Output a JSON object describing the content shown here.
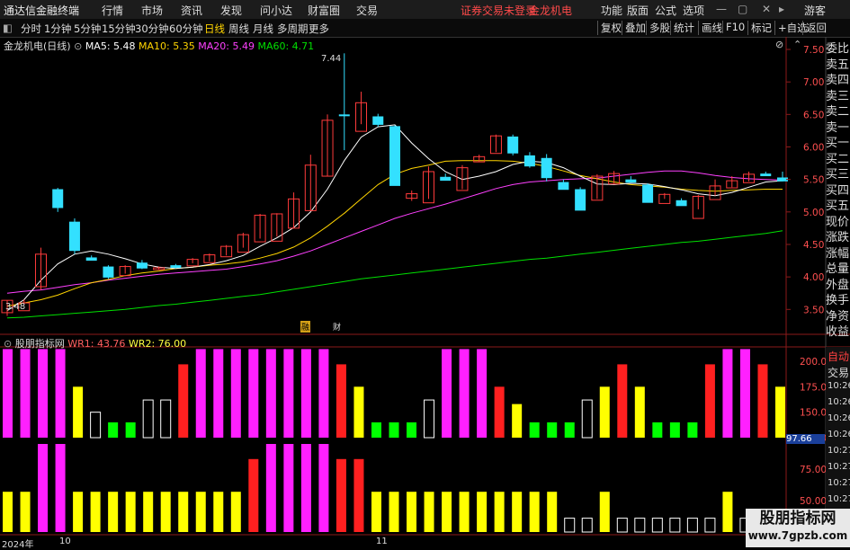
{
  "window": {
    "app_title": "通达信金融终端",
    "warning": "证券交易未登录",
    "stock_title": "金龙机电",
    "menus": [
      "行情",
      "市场",
      "资讯",
      "发现",
      "问小达",
      "财富圈",
      "交易"
    ],
    "right_menus": [
      "功能",
      "版面",
      "公式",
      "选项"
    ],
    "guest": "游客"
  },
  "toolbar": {
    "periods": [
      "分时",
      "1分钟",
      "5分钟",
      "15分钟",
      "30分钟",
      "60分钟",
      "日线",
      "周线",
      "月线",
      "多周期",
      "更多"
    ],
    "active": "日线",
    "right": [
      "复权",
      "叠加",
      "多股",
      "统计",
      "画线",
      "F10",
      "标记",
      "+自选",
      "返回"
    ]
  },
  "upper": {
    "name": "金龙机电(日线)",
    "ma": [
      {
        "label": "MA5: 5.48",
        "color": "#ffffff"
      },
      {
        "label": "MA10: 5.35",
        "color": "#ffd400"
      },
      {
        "label": "MA20: 5.49",
        "color": "#ff40ff"
      },
      {
        "label": "MA60: 4.71",
        "color": "#00e000"
      }
    ],
    "yaxis": [
      "7.50",
      "7.00",
      "6.50",
      "6.00",
      "5.50",
      "5.00",
      "4.50",
      "4.00",
      "3.50"
    ],
    "high_label": "7.44",
    "low_label": "3.48",
    "markers": [
      "融",
      "财"
    ]
  },
  "lower": {
    "name": "股朋指标网",
    "wr1": "WR1: 43.76",
    "wr2": "WR2: 76.00",
    "yaxis": [
      "200.0",
      "175.0",
      "150.0",
      "125.0",
      "75.00",
      "50.00",
      "25.00"
    ],
    "current": "97.66"
  },
  "date_axis": [
    "2024年",
    "10",
    "11"
  ],
  "sidepanel": [
    "委比",
    "卖五",
    "卖四",
    "卖三",
    "卖二",
    "卖一",
    "买一",
    "买二",
    "买三",
    "买四",
    "买五",
    "现价",
    "涨跌",
    "涨幅",
    "总量",
    "外盘",
    "换手",
    "净资",
    "收益"
  ],
  "sidebottom": [
    "自动",
    "交易",
    "10:26",
    "10:26",
    "10:26",
    "10:26",
    "10:27",
    "10:27",
    "10:27",
    "10:27",
    "10:27",
    "10:27"
  ],
  "watermark": {
    "line1": "股朋指标网",
    "line2": "www.7gpzb.com"
  },
  "chart_data": {
    "type": "candlestick",
    "candles": [
      [
        3.64,
        3.64,
        3.4,
        3.45,
        "r"
      ],
      [
        3.6,
        3.65,
        3.58,
        3.48,
        "r"
      ],
      [
        4.35,
        4.45,
        3.8,
        3.85,
        "r"
      ],
      [
        5.35,
        5.37,
        5.0,
        5.06,
        "c"
      ],
      [
        4.85,
        4.9,
        4.35,
        4.4,
        "c"
      ],
      [
        4.3,
        4.33,
        4.27,
        4.25,
        "c"
      ],
      [
        4.16,
        4.18,
        3.97,
        3.99,
        "c"
      ],
      [
        4.16,
        4.18,
        4.05,
        4.02,
        "r"
      ],
      [
        4.22,
        4.26,
        4.12,
        4.13,
        "c"
      ],
      [
        4.14,
        4.16,
        4.12,
        4.12,
        "r"
      ],
      [
        4.18,
        4.2,
        4.13,
        4.14,
        "c"
      ],
      [
        4.27,
        4.29,
        4.21,
        4.17,
        "r"
      ],
      [
        4.34,
        4.36,
        4.24,
        4.22,
        "r"
      ],
      [
        4.47,
        4.49,
        4.33,
        4.31,
        "r"
      ],
      [
        4.65,
        4.68,
        4.45,
        4.38,
        "r"
      ],
      [
        4.95,
        4.97,
        4.59,
        4.54,
        "r"
      ],
      [
        4.97,
        4.98,
        4.62,
        4.55,
        "r"
      ],
      [
        5.2,
        5.3,
        4.75,
        4.75,
        "r"
      ],
      [
        5.72,
        5.88,
        5.02,
        5.02,
        "r"
      ],
      [
        6.41,
        6.5,
        5.55,
        5.55,
        "r"
      ],
      [
        6.5,
        7.44,
        5.95,
        6.49,
        "c"
      ],
      [
        6.68,
        6.85,
        6.35,
        6.24,
        "r"
      ],
      [
        6.47,
        6.51,
        6.31,
        6.34,
        "c"
      ],
      [
        6.32,
        6.33,
        5.45,
        5.4,
        "c"
      ],
      [
        5.28,
        5.33,
        5.17,
        5.21,
        "r"
      ],
      [
        5.62,
        5.7,
        5.2,
        5.14,
        "r"
      ],
      [
        5.54,
        5.59,
        5.49,
        5.48,
        "c"
      ],
      [
        5.68,
        5.72,
        5.35,
        5.33,
        "r"
      ],
      [
        5.85,
        5.88,
        5.77,
        5.77,
        "r"
      ],
      [
        6.17,
        6.19,
        5.92,
        5.9,
        "r"
      ],
      [
        6.16,
        6.19,
        5.87,
        5.9,
        "c"
      ],
      [
        5.87,
        5.92,
        5.68,
        5.7,
        "c"
      ],
      [
        5.83,
        5.89,
        5.47,
        5.52,
        "c"
      ],
      [
        5.46,
        5.5,
        5.36,
        5.34,
        "c"
      ],
      [
        5.35,
        5.38,
        5.08,
        5.02,
        "c"
      ],
      [
        5.55,
        5.58,
        5.2,
        5.18,
        "r"
      ],
      [
        5.59,
        5.63,
        5.44,
        5.43,
        "r"
      ],
      [
        5.5,
        5.55,
        5.46,
        5.45,
        "c"
      ],
      [
        5.42,
        5.44,
        5.17,
        5.14,
        "c"
      ],
      [
        5.27,
        5.29,
        5.2,
        5.13,
        "r"
      ],
      [
        5.18,
        5.21,
        5.12,
        5.09,
        "c"
      ],
      [
        5.24,
        5.26,
        5.04,
        4.9,
        "r"
      ],
      [
        5.4,
        5.5,
        5.25,
        5.19,
        "r"
      ],
      [
        5.48,
        5.55,
        5.38,
        5.37,
        "r"
      ],
      [
        5.58,
        5.62,
        5.47,
        5.45,
        "r"
      ],
      [
        5.59,
        5.62,
        5.56,
        5.55,
        "c"
      ],
      [
        5.53,
        5.62,
        5.47,
        5.47,
        "c"
      ]
    ],
    "ma5": [
      3.48,
      3.65,
      3.95,
      4.2,
      4.35,
      4.4,
      4.35,
      4.28,
      4.2,
      4.15,
      4.13,
      4.15,
      4.19,
      4.25,
      4.33,
      4.47,
      4.6,
      4.76,
      5.0,
      5.35,
      5.79,
      6.15,
      6.31,
      6.34,
      6.06,
      5.82,
      5.62,
      5.5,
      5.55,
      5.62,
      5.73,
      5.78,
      5.76,
      5.68,
      5.55,
      5.43,
      5.42,
      5.44,
      5.43,
      5.39,
      5.34,
      5.28,
      5.25,
      5.3,
      5.38,
      5.46,
      5.48
    ],
    "ma10": [
      3.55,
      3.6,
      3.65,
      3.72,
      3.82,
      3.91,
      3.96,
      4.02,
      4.06,
      4.09,
      4.13,
      4.15,
      4.18,
      4.2,
      4.23,
      4.29,
      4.36,
      4.46,
      4.6,
      4.78,
      4.98,
      5.2,
      5.42,
      5.58,
      5.67,
      5.72,
      5.78,
      5.79,
      5.79,
      5.79,
      5.78,
      5.75,
      5.7,
      5.63,
      5.56,
      5.51,
      5.46,
      5.42,
      5.4,
      5.38,
      5.35,
      5.33,
      5.32,
      5.33,
      5.34,
      5.35,
      5.35
    ],
    "ma20": [
      3.75,
      3.78,
      3.8,
      3.84,
      3.88,
      3.91,
      3.95,
      3.98,
      4.01,
      4.04,
      4.06,
      4.08,
      4.1,
      4.12,
      4.16,
      4.2,
      4.25,
      4.32,
      4.4,
      4.5,
      4.6,
      4.7,
      4.8,
      4.9,
      4.98,
      5.05,
      5.12,
      5.2,
      5.28,
      5.36,
      5.42,
      5.46,
      5.48,
      5.5,
      5.51,
      5.52,
      5.55,
      5.58,
      5.61,
      5.63,
      5.63,
      5.6,
      5.56,
      5.53,
      5.51,
      5.5,
      5.49
    ],
    "ma60": [
      3.37,
      3.38,
      3.4,
      3.42,
      3.44,
      3.46,
      3.48,
      3.5,
      3.53,
      3.56,
      3.58,
      3.61,
      3.64,
      3.67,
      3.7,
      3.73,
      3.77,
      3.81,
      3.85,
      3.89,
      3.93,
      3.97,
      4.0,
      4.03,
      4.06,
      4.09,
      4.12,
      4.15,
      4.18,
      4.21,
      4.24,
      4.27,
      4.29,
      4.32,
      4.35,
      4.38,
      4.41,
      4.44,
      4.47,
      4.5,
      4.53,
      4.55,
      4.58,
      4.61,
      4.64,
      4.67,
      4.71
    ],
    "wr1_colors": [
      "m",
      "m",
      "m",
      "m",
      "y",
      "w",
      "g",
      "g",
      "w",
      "w",
      "r",
      "m",
      "m",
      "m",
      "m",
      "m",
      "m",
      "m",
      "m",
      "r",
      "y",
      "g",
      "g",
      "g",
      "w",
      "m",
      "m",
      "m",
      "r",
      "y",
      "g",
      "g",
      "g",
      "w",
      "y",
      "r",
      "y",
      "g",
      "g",
      "g",
      "r",
      "m",
      "m",
      "r",
      "y"
    ],
    "wr1_values": [
      212,
      212,
      212,
      212,
      175,
      150,
      140,
      140,
      162,
      162,
      197,
      212,
      212,
      212,
      212,
      212,
      212,
      212,
      212,
      197,
      175,
      140,
      140,
      140,
      162,
      212,
      212,
      212,
      175,
      158,
      140,
      140,
      140,
      162,
      175,
      197,
      175,
      140,
      140,
      140,
      197,
      212,
      212,
      197,
      175
    ],
    "wr2_colors": [
      "y",
      "y",
      "m",
      "m",
      "y",
      "y",
      "y",
      "y",
      "y",
      "y",
      "y",
      "y",
      "y",
      "y",
      "r",
      "m",
      "m",
      "m",
      "m",
      "r",
      "r",
      "y",
      "y",
      "y",
      "y",
      "y",
      "y",
      "y",
      "y",
      "y",
      "y",
      "y",
      "w",
      "w",
      "y",
      "w",
      "w",
      "w",
      "w",
      "w",
      "w",
      "y",
      "w",
      "w",
      "w"
    ],
    "wr2_values": [
      57,
      57,
      95,
      95,
      57,
      57,
      57,
      57,
      57,
      57,
      57,
      57,
      57,
      57,
      83,
      95,
      95,
      95,
      95,
      83,
      83,
      57,
      57,
      57,
      57,
      57,
      57,
      57,
      57,
      57,
      57,
      57,
      36,
      36,
      57,
      36,
      36,
      36,
      36,
      36,
      36,
      57,
      36,
      36,
      36
    ]
  }
}
